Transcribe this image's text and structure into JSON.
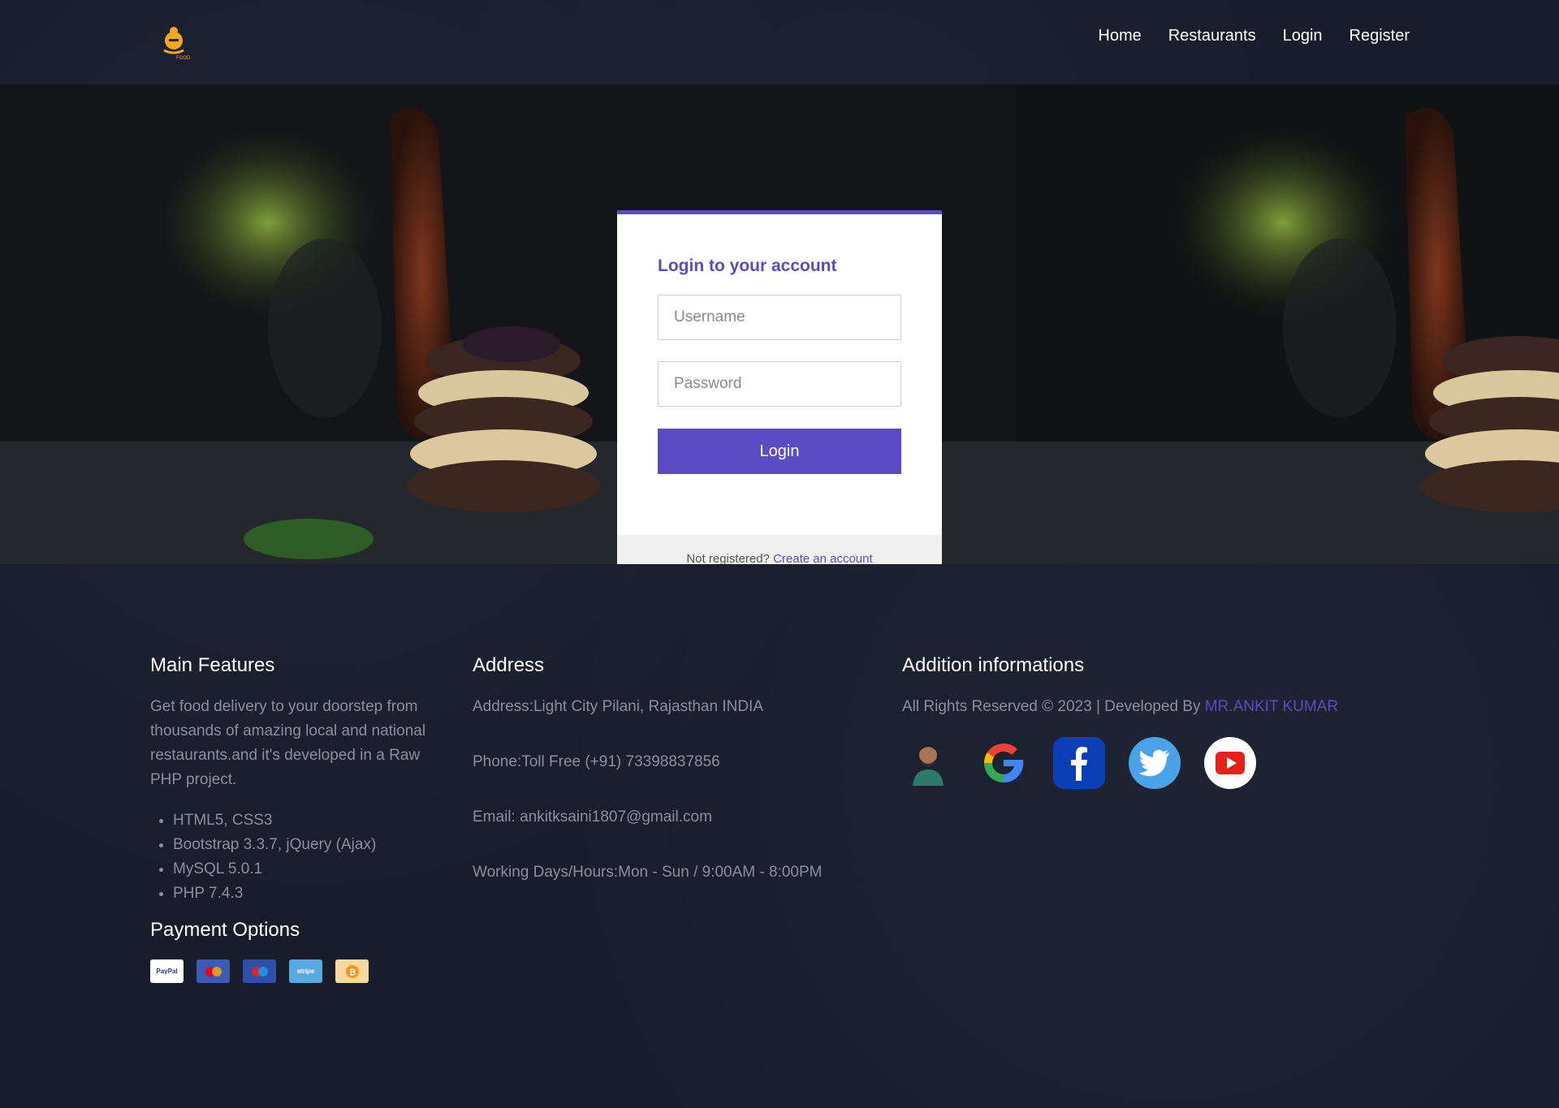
{
  "nav": {
    "logo_text": "FOOD",
    "links": [
      "Home",
      "Restaurants",
      "Login",
      "Register"
    ]
  },
  "login": {
    "title": "Login to your account",
    "username_placeholder": "Username",
    "password_placeholder": "Password",
    "button_label": "Login",
    "footer_prompt": "Not registered?",
    "footer_link": "Create an account"
  },
  "footer": {
    "features": {
      "title": "Main Features",
      "description": "Get food delivery to your doorstep from thousands of amazing local and national restaurants.and it's developed in a Raw PHP project.",
      "items": [
        "HTML5, CSS3",
        "Bootstrap 3.3.7, jQuery (Ajax)",
        "MySQL 5.0.1",
        "PHP 7.4.3"
      ]
    },
    "payment": {
      "title": "Payment Options",
      "methods": [
        "paypal-icon",
        "mastercard-icon",
        "maestro-icon",
        "stripe-icon",
        "bitcoin-icon"
      ],
      "paypal_label": "PayPal",
      "stripe_label": "stripe",
      "bitcoin_label": "₿"
    },
    "address": {
      "title": "Address",
      "address": "Address:Light City Pilani, Rajasthan INDIA",
      "phone": "Phone:Toll Free (+91) 73398837856",
      "email": "Email: ankitksaini1807@gmail.com",
      "hours": "Working Days/Hours:Mon - Sun / 9:00AM - 8:00PM"
    },
    "additional": {
      "title": "Addition informations",
      "credit_prefix": "All Rights Reserved © 2023 | Developed By ",
      "credit_name": "MR.ANKIT KUMAR",
      "socials": [
        "avatar",
        "google-icon",
        "facebook-icon",
        "twitter-icon",
        "youtube-icon"
      ]
    }
  },
  "colors": {
    "accent": "#5b4bc4",
    "background": "#181d2c",
    "muted_text": "#8a8fa0"
  }
}
